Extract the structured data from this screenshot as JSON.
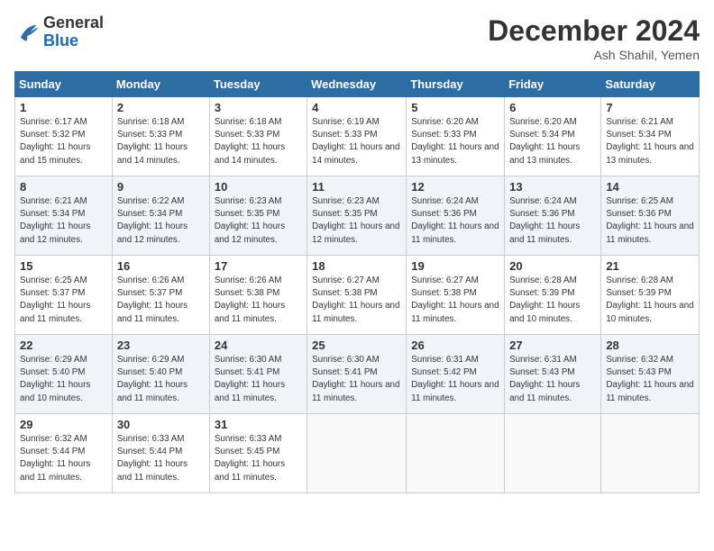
{
  "header": {
    "logo_general": "General",
    "logo_blue": "Blue",
    "month_title": "December 2024",
    "location": "Ash Shahil, Yemen"
  },
  "days_of_week": [
    "Sunday",
    "Monday",
    "Tuesday",
    "Wednesday",
    "Thursday",
    "Friday",
    "Saturday"
  ],
  "weeks": [
    [
      {
        "day": "1",
        "sunrise": "6:17 AM",
        "sunset": "5:32 PM",
        "daylight": "11 hours and 15 minutes."
      },
      {
        "day": "2",
        "sunrise": "6:18 AM",
        "sunset": "5:33 PM",
        "daylight": "11 hours and 14 minutes."
      },
      {
        "day": "3",
        "sunrise": "6:18 AM",
        "sunset": "5:33 PM",
        "daylight": "11 hours and 14 minutes."
      },
      {
        "day": "4",
        "sunrise": "6:19 AM",
        "sunset": "5:33 PM",
        "daylight": "11 hours and 14 minutes."
      },
      {
        "day": "5",
        "sunrise": "6:20 AM",
        "sunset": "5:33 PM",
        "daylight": "11 hours and 13 minutes."
      },
      {
        "day": "6",
        "sunrise": "6:20 AM",
        "sunset": "5:34 PM",
        "daylight": "11 hours and 13 minutes."
      },
      {
        "day": "7",
        "sunrise": "6:21 AM",
        "sunset": "5:34 PM",
        "daylight": "11 hours and 13 minutes."
      }
    ],
    [
      {
        "day": "8",
        "sunrise": "6:21 AM",
        "sunset": "5:34 PM",
        "daylight": "11 hours and 12 minutes."
      },
      {
        "day": "9",
        "sunrise": "6:22 AM",
        "sunset": "5:34 PM",
        "daylight": "11 hours and 12 minutes."
      },
      {
        "day": "10",
        "sunrise": "6:23 AM",
        "sunset": "5:35 PM",
        "daylight": "11 hours and 12 minutes."
      },
      {
        "day": "11",
        "sunrise": "6:23 AM",
        "sunset": "5:35 PM",
        "daylight": "11 hours and 12 minutes."
      },
      {
        "day": "12",
        "sunrise": "6:24 AM",
        "sunset": "5:36 PM",
        "daylight": "11 hours and 11 minutes."
      },
      {
        "day": "13",
        "sunrise": "6:24 AM",
        "sunset": "5:36 PM",
        "daylight": "11 hours and 11 minutes."
      },
      {
        "day": "14",
        "sunrise": "6:25 AM",
        "sunset": "5:36 PM",
        "daylight": "11 hours and 11 minutes."
      }
    ],
    [
      {
        "day": "15",
        "sunrise": "6:25 AM",
        "sunset": "5:37 PM",
        "daylight": "11 hours and 11 minutes."
      },
      {
        "day": "16",
        "sunrise": "6:26 AM",
        "sunset": "5:37 PM",
        "daylight": "11 hours and 11 minutes."
      },
      {
        "day": "17",
        "sunrise": "6:26 AM",
        "sunset": "5:38 PM",
        "daylight": "11 hours and 11 minutes."
      },
      {
        "day": "18",
        "sunrise": "6:27 AM",
        "sunset": "5:38 PM",
        "daylight": "11 hours and 11 minutes."
      },
      {
        "day": "19",
        "sunrise": "6:27 AM",
        "sunset": "5:38 PM",
        "daylight": "11 hours and 11 minutes."
      },
      {
        "day": "20",
        "sunrise": "6:28 AM",
        "sunset": "5:39 PM",
        "daylight": "11 hours and 10 minutes."
      },
      {
        "day": "21",
        "sunrise": "6:28 AM",
        "sunset": "5:39 PM",
        "daylight": "11 hours and 10 minutes."
      }
    ],
    [
      {
        "day": "22",
        "sunrise": "6:29 AM",
        "sunset": "5:40 PM",
        "daylight": "11 hours and 10 minutes."
      },
      {
        "day": "23",
        "sunrise": "6:29 AM",
        "sunset": "5:40 PM",
        "daylight": "11 hours and 11 minutes."
      },
      {
        "day": "24",
        "sunrise": "6:30 AM",
        "sunset": "5:41 PM",
        "daylight": "11 hours and 11 minutes."
      },
      {
        "day": "25",
        "sunrise": "6:30 AM",
        "sunset": "5:41 PM",
        "daylight": "11 hours and 11 minutes."
      },
      {
        "day": "26",
        "sunrise": "6:31 AM",
        "sunset": "5:42 PM",
        "daylight": "11 hours and 11 minutes."
      },
      {
        "day": "27",
        "sunrise": "6:31 AM",
        "sunset": "5:43 PM",
        "daylight": "11 hours and 11 minutes."
      },
      {
        "day": "28",
        "sunrise": "6:32 AM",
        "sunset": "5:43 PM",
        "daylight": "11 hours and 11 minutes."
      }
    ],
    [
      {
        "day": "29",
        "sunrise": "6:32 AM",
        "sunset": "5:44 PM",
        "daylight": "11 hours and 11 minutes."
      },
      {
        "day": "30",
        "sunrise": "6:33 AM",
        "sunset": "5:44 PM",
        "daylight": "11 hours and 11 minutes."
      },
      {
        "day": "31",
        "sunrise": "6:33 AM",
        "sunset": "5:45 PM",
        "daylight": "11 hours and 11 minutes."
      },
      null,
      null,
      null,
      null
    ]
  ]
}
